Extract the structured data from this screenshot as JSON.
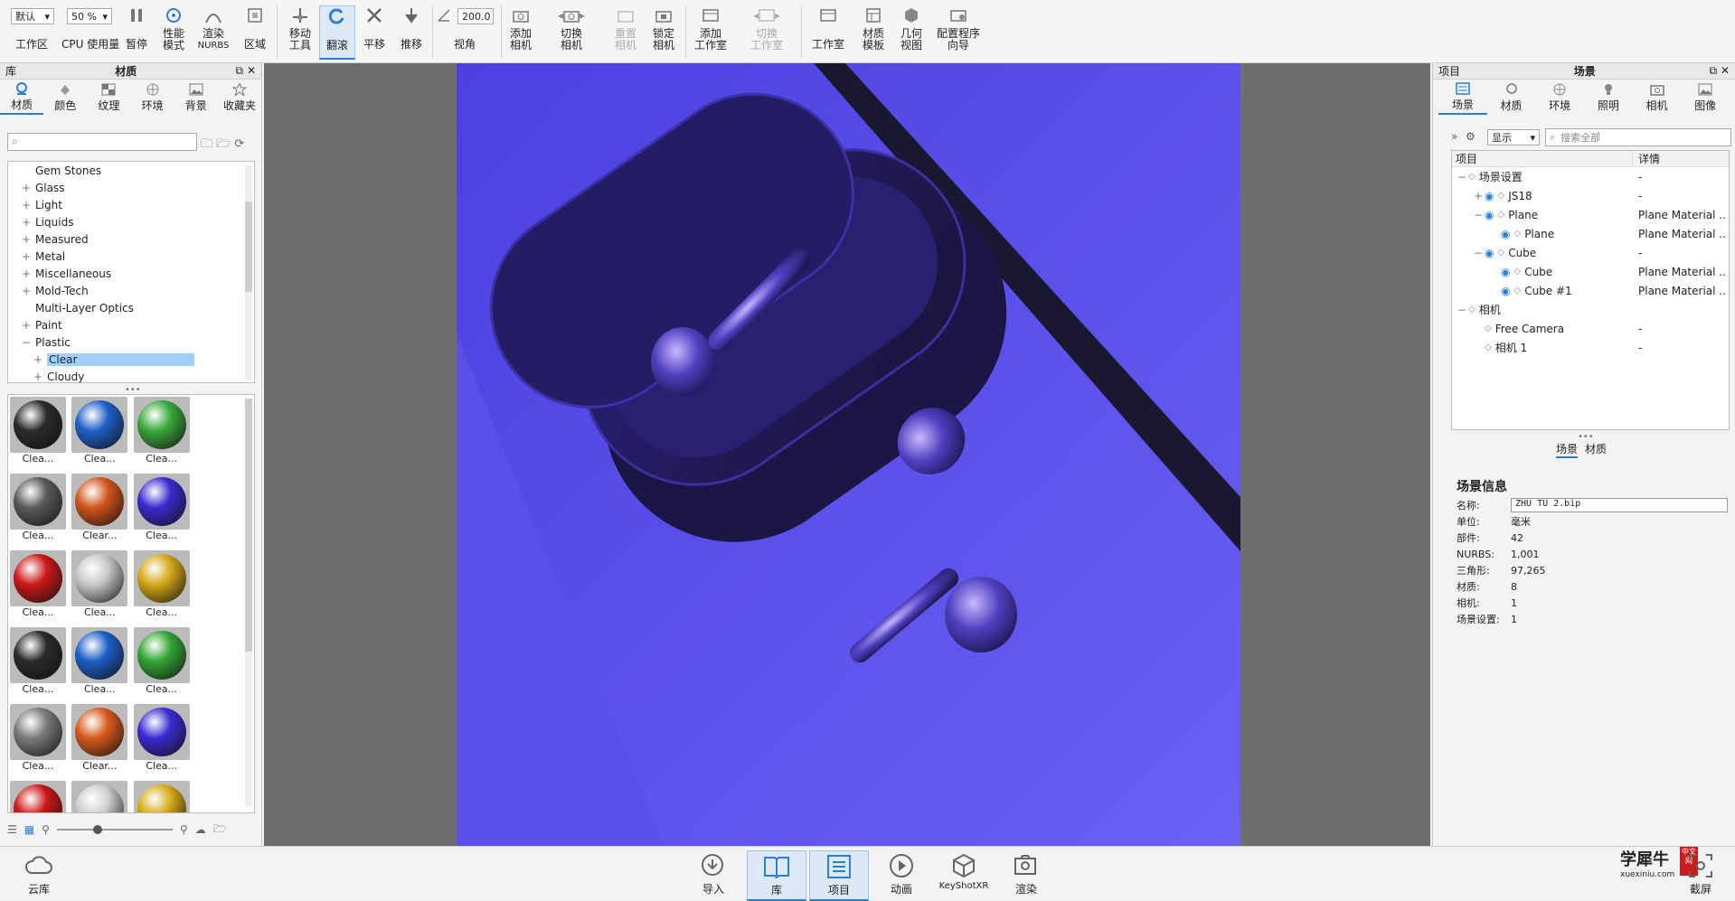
{
  "toolbar": {
    "workspace_select": "默认",
    "cpu_select": "50 %",
    "workspace_label": "工作区",
    "cpu_label": "CPU 使用量",
    "pause": "暂停",
    "perf_mode": [
      "性能",
      "模式"
    ],
    "render_nurbs": [
      "渲染",
      "NURBS"
    ],
    "region": "区域",
    "move_tool": [
      "移动",
      "工具"
    ],
    "tumble": "翻滚",
    "pan": "平移",
    "dolly": "推移",
    "fov_value": "200.0",
    "fov_label": "视角",
    "add_camera": [
      "添加",
      "相机"
    ],
    "switch_camera": [
      "切换",
      "相机"
    ],
    "reset_camera": [
      "重置",
      "相机"
    ],
    "lock_camera": [
      "锁定",
      "相机"
    ],
    "add_studio": [
      "添加",
      "工作室"
    ],
    "switch_studio": [
      "切换",
      "工作室"
    ],
    "studio": "工作室",
    "material_template": [
      "材质",
      "模板"
    ],
    "geometry_view": [
      "几何",
      "视图"
    ],
    "config_wizard": [
      "配置程序",
      "向导"
    ]
  },
  "library": {
    "title_left": "库",
    "title": "材质",
    "tabs": [
      "材质",
      "颜色",
      "纹理",
      "环境",
      "背景",
      "收藏夹"
    ],
    "tree": [
      {
        "label": "Gem Stones",
        "pm": "",
        "indent": 0
      },
      {
        "label": "Glass",
        "pm": "+",
        "indent": 0
      },
      {
        "label": "Light",
        "pm": "+",
        "indent": 0
      },
      {
        "label": "Liquids",
        "pm": "+",
        "indent": 0
      },
      {
        "label": "Measured",
        "pm": "+",
        "indent": 0
      },
      {
        "label": "Metal",
        "pm": "+",
        "indent": 0
      },
      {
        "label": "Miscellaneous",
        "pm": "+",
        "indent": 0
      },
      {
        "label": "Mold-Tech",
        "pm": "+",
        "indent": 0
      },
      {
        "label": "Multi-Layer Optics",
        "pm": "",
        "indent": 0
      },
      {
        "label": "Paint",
        "pm": "+",
        "indent": 0
      },
      {
        "label": "Plastic",
        "pm": "−",
        "indent": 0
      },
      {
        "label": "Clear",
        "pm": "+",
        "indent": 1,
        "selected": true
      },
      {
        "label": "Cloudy",
        "pm": "+",
        "indent": 1
      }
    ],
    "swatches": [
      {
        "label": "Clea...",
        "color": "#2b2b2b"
      },
      {
        "label": "Clea...",
        "color": "#1f5fc8"
      },
      {
        "label": "Clea...",
        "color": "#3aa83a"
      },
      {
        "label": "Clea...",
        "color": "#5a5a5a"
      },
      {
        "label": "Clear...",
        "color": "#d2541a"
      },
      {
        "label": "Clea...",
        "color": "#3a2ad0"
      },
      {
        "label": "Clea...",
        "color": "#cc1818"
      },
      {
        "label": "Clea...",
        "color": "#c8c8c8"
      },
      {
        "label": "Clea...",
        "color": "#d4a817"
      },
      {
        "label": "Clea...",
        "color": "#2a2a2a"
      },
      {
        "label": "Clea...",
        "color": "#1d5ec6"
      },
      {
        "label": "Clea...",
        "color": "#34a534"
      },
      {
        "label": "Clea...",
        "color": "#7a7a7a"
      },
      {
        "label": "Clear...",
        "color": "#d65a1c"
      },
      {
        "label": "Clea...",
        "color": "#3b2bd2"
      },
      {
        "label": "",
        "color": "#cc1818"
      },
      {
        "label": "",
        "color": "#cfcfcf"
      },
      {
        "label": "",
        "color": "#d6ad1a"
      }
    ]
  },
  "project": {
    "title_left": "项目",
    "title": "场景",
    "tabs": [
      "场景",
      "材质",
      "环境",
      "照明",
      "相机",
      "图像"
    ],
    "display_select": "显示",
    "search_placeholder": "搜索全部",
    "col_item": "项目",
    "col_detail": "详情",
    "rows": [
      {
        "label": "场景设置",
        "detail": "-",
        "indent": 0,
        "pm": "−",
        "eye": false
      },
      {
        "label": "JS18",
        "detail": "-",
        "indent": 1,
        "pm": "+",
        "eye": true
      },
      {
        "label": "Plane",
        "detail": "Plane Material ...",
        "indent": 1,
        "pm": "−",
        "eye": true
      },
      {
        "label": "Plane",
        "detail": "Plane Material ...",
        "indent": 2,
        "pm": "",
        "eye": true
      },
      {
        "label": "Cube",
        "detail": "-",
        "indent": 1,
        "pm": "−",
        "eye": true
      },
      {
        "label": "Cube",
        "detail": "Plane Material ...",
        "indent": 2,
        "pm": "",
        "eye": true
      },
      {
        "label": "Cube #1",
        "detail": "Plane Material ...",
        "indent": 2,
        "pm": "",
        "eye": true
      },
      {
        "label": "相机",
        "detail": "",
        "indent": 0,
        "pm": "−",
        "eye": false
      },
      {
        "label": "Free Camera",
        "detail": "-",
        "indent": 1,
        "pm": "",
        "eye": false
      },
      {
        "label": "相机 1",
        "detail": "-",
        "indent": 1,
        "pm": "",
        "eye": false
      }
    ],
    "subtabs": [
      "场景",
      "材质"
    ],
    "info_title": "场景信息",
    "info": {
      "name_k": "名称:",
      "name_v": "ZHU TU 2.bip",
      "unit_k": "单位:",
      "unit_v": "毫米",
      "parts_k": "部件:",
      "parts_v": "42",
      "nurbs_k": "NURBS:",
      "nurbs_v": "1,001",
      "tri_k": "三角形:",
      "tri_v": "97,265",
      "mat_k": "材质:",
      "mat_v": "8",
      "cam_k": "相机:",
      "cam_v": "1",
      "scene_k": "场景设置:",
      "scene_v": "1"
    }
  },
  "bottombar": {
    "cloud": "云库",
    "import": "导入",
    "library": "库",
    "project": "项目",
    "animation": "动画",
    "keyshotxr": "KeyShotXR",
    "render": "渲染",
    "screenshot": "截屏",
    "watermark_cn": "学犀牛",
    "watermark_url": "xuexiniu.com",
    "watermark_badge": "中文网"
  },
  "colors": {
    "accent": "#2a7fd4",
    "render_bg": "#5a4ee6",
    "viewport_bg": "#6e6e6e"
  }
}
